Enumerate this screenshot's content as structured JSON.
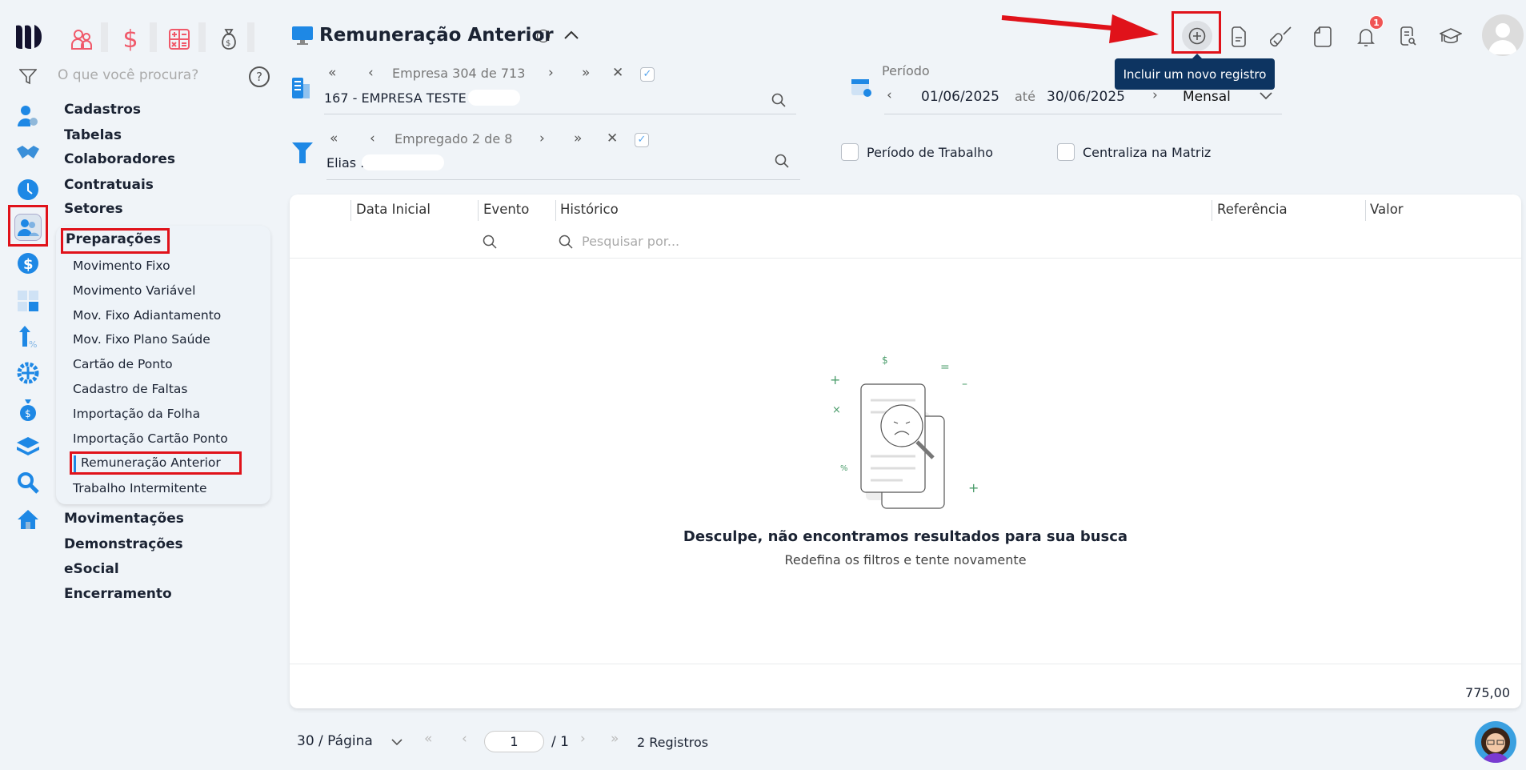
{
  "top_modules": [
    "people-icon",
    "dollar-icon",
    "calculator-icon",
    "money-bag-icon"
  ],
  "search": {
    "placeholder": "O que você procura?"
  },
  "menu": {
    "top": [
      "Cadastros",
      "Tabelas",
      "Colaboradores",
      "Contratuais",
      "Setores"
    ],
    "expanded": {
      "label": "Preparações",
      "items": [
        "Movimento Fixo",
        "Movimento Variável",
        "Mov. Fixo Adiantamento",
        "Mov. Fixo Plano Saúde",
        "Cartão de Ponto",
        "Cadastro de Faltas",
        "Importação da Folha",
        "Importação Cartão Ponto",
        "Remuneração Anterior",
        "Trabalho Intermitente"
      ],
      "active": "Remuneração Anterior"
    },
    "bottom": [
      "Movimentações",
      "Demonstrações",
      "eSocial",
      "Encerramento"
    ]
  },
  "header": {
    "title": "Remuneração Anterior",
    "tooltip": "Incluir um novo registro",
    "notification_count": "1"
  },
  "empresa": {
    "nav": "Empresa 304 de 713",
    "value": "167 - EMPRESA TESTE ."
  },
  "empregado": {
    "nav": "Empregado 2 de 8",
    "value": "Elias ."
  },
  "periodo": {
    "label": "Período",
    "start": "01/06/2025",
    "sep": "até",
    "end": "30/06/2025",
    "mode": "Mensal"
  },
  "options": {
    "periodo_trabalho": "Período de Trabalho",
    "centraliza": "Centraliza na Matriz"
  },
  "table": {
    "columns": [
      "Data Inicial",
      "Evento",
      "Histórico",
      "Referência",
      "Valor"
    ],
    "search_placeholder": "Pesquisar por...",
    "empty_title": "Desculpe, não encontramos resultados para sua busca",
    "empty_sub": "Redefina os filtros e tente novamente",
    "total": "775,00"
  },
  "pagination": {
    "page_size": "30 / Página",
    "page": "1",
    "total_pages": "/ 1",
    "records": "2 Registros"
  },
  "colors": {
    "accent": "#1e88e5",
    "tooltip": "#0d3461",
    "highlight": "#e0121a",
    "module": "#f0596a"
  }
}
